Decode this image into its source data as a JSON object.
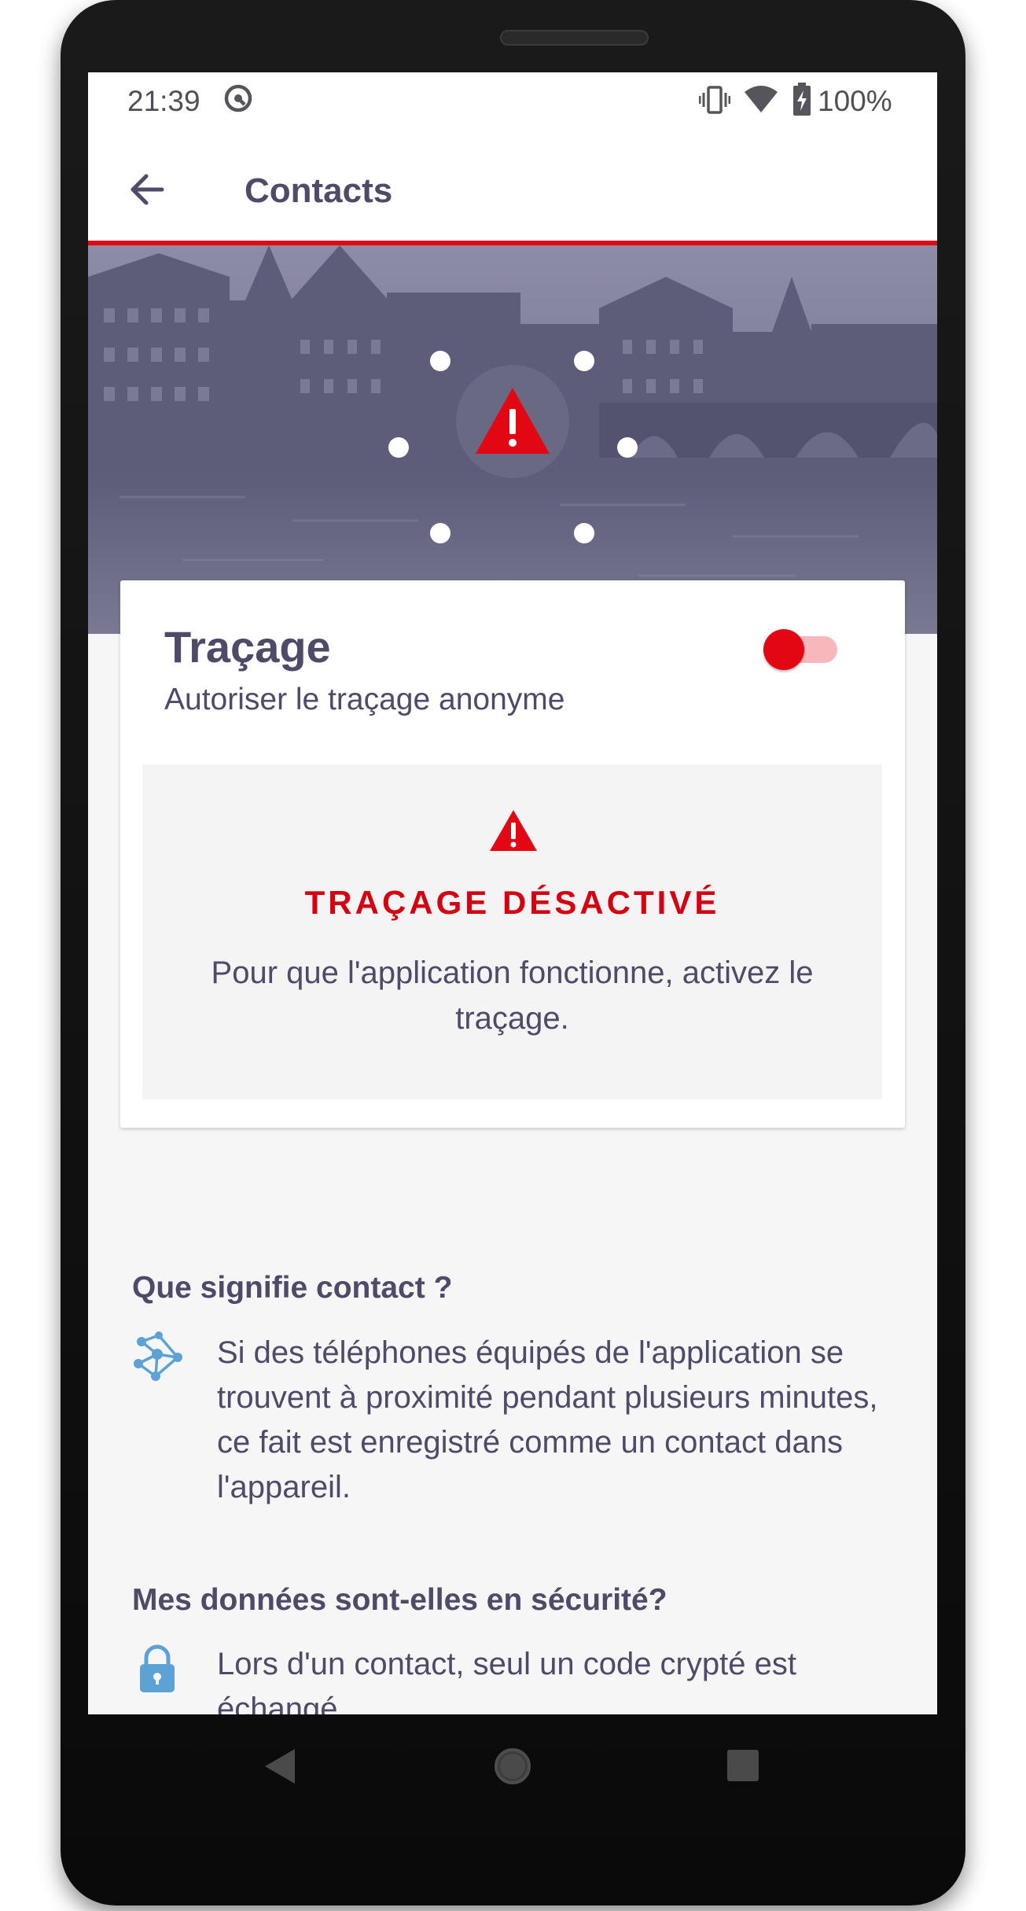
{
  "status_bar": {
    "time": "21:39",
    "battery_percent": "100%",
    "icons": [
      "vpn-key-icon",
      "vibrate-icon",
      "wifi-icon",
      "battery-charging-icon"
    ]
  },
  "app_bar": {
    "title": "Contacts",
    "back_icon": "arrow-left-icon"
  },
  "hero": {
    "icon": "warning-triangle-icon"
  },
  "tracing_card": {
    "title": "Traçage",
    "subtitle": "Autoriser le traçage anonyme",
    "toggle_on": false,
    "warning": {
      "icon": "warning-triangle-icon",
      "title": "TRAÇAGE DÉSACTIVÉ",
      "body": "Pour que l'application fonctionne, activez le traçage."
    }
  },
  "info_sections": [
    {
      "heading": "Que signifie contact ?",
      "icon": "network-nodes-icon",
      "body": "Si des téléphones équipés de l'application se trouvent à proximité pendant plusieurs minutes, ce fait est enregistré comme un contact dans l'appareil."
    },
    {
      "heading": "Mes données sont-elles en sécurité?",
      "icon": "lock-icon",
      "body": "Lors d'un contact, seul un code crypté est échangé."
    }
  ],
  "nav_bar": {
    "icons": [
      "nav-back-icon",
      "nav-home-icon",
      "nav-recents-icon"
    ]
  },
  "colors": {
    "accent_red": "#e30613",
    "text_primary": "#4d4b68",
    "icon_blue": "#5da2d5",
    "hero_tint": "#6f6e8b"
  }
}
